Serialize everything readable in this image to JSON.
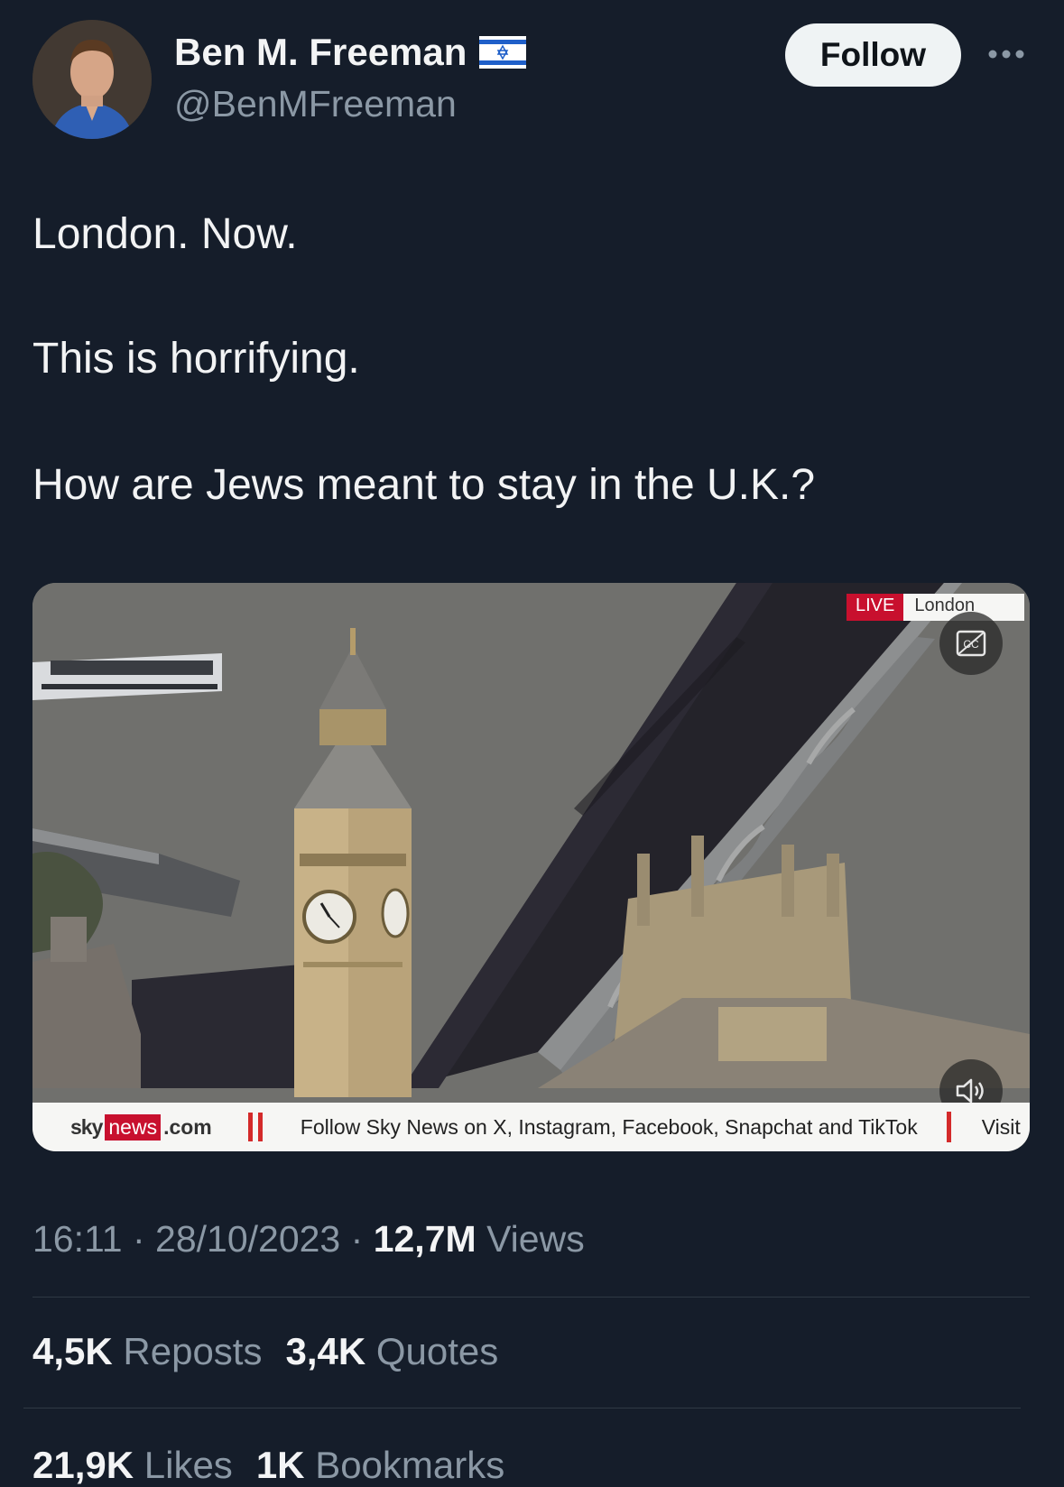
{
  "author": {
    "name": "Ben M. Freeman",
    "handle": "@BenMFreeman",
    "flag_icon": "israel-flag-icon"
  },
  "follow_label": "Follow",
  "tweet": {
    "lines": [
      "London. Now.",
      "This is horrifying.",
      "How are Jews meant to stay in the U.K.?"
    ]
  },
  "media": {
    "live_label": "LIVE",
    "location_label": "London",
    "logo": {
      "sky": "sky",
      "news": "news",
      "com": ".com"
    },
    "ticker_text": "Follow Sky News on X, Instagram, Facebook, Snapchat and TikTok",
    "ticker_visit": "Visit",
    "captions_icon": "closed-captions-icon",
    "mute_icon": "speaker-icon"
  },
  "meta": {
    "time": "16:11",
    "separator": "·",
    "date": "28/10/2023",
    "views_count": "12,7M",
    "views_label": "Views"
  },
  "stats": {
    "reposts_count": "4,5K",
    "reposts_label": "Reposts",
    "quotes_count": "3,4K",
    "quotes_label": "Quotes",
    "likes_count": "21,9K",
    "likes_label": "Likes",
    "bookmarks_count": "1K",
    "bookmarks_label": "Bookmarks"
  },
  "colors": {
    "background": "#151d2a",
    "text": "#e7e9ea",
    "muted": "#8b98a5",
    "sky_red": "#c8102e"
  }
}
